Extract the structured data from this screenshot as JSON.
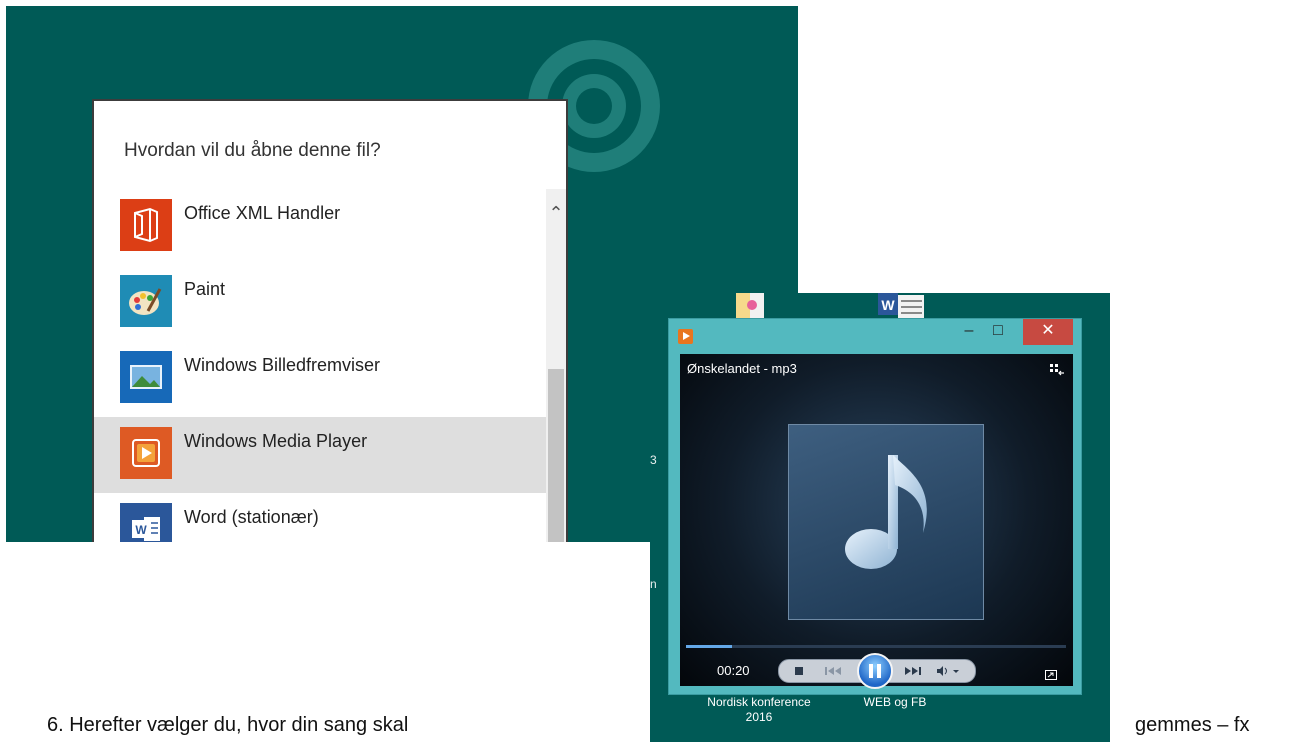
{
  "dialog": {
    "title": "Hvordan vil du åbne denne fil?",
    "apps": [
      {
        "label": "Office XML Handler",
        "icon": "office-icon",
        "selected": false
      },
      {
        "label": "Paint",
        "icon": "paint-icon",
        "selected": false
      },
      {
        "label": "Windows Billedfremviser",
        "icon": "photo-viewer-icon",
        "selected": false
      },
      {
        "label": "Windows Media Player",
        "icon": "media-player-icon",
        "selected": true
      },
      {
        "label": "Word (stationær)",
        "icon": "word-icon",
        "selected": false
      }
    ]
  },
  "media_player": {
    "track_title": "Ønskelandet - mp3",
    "elapsed_time": "00:20",
    "progress": 0.12,
    "state": "playing"
  },
  "desktop": {
    "fragments": [
      "3",
      "n"
    ],
    "labels": [
      "Nordisk konference 2016",
      "WEB og FB"
    ]
  },
  "page_text": {
    "left": "6.   Herefter vælger du, hvor din sang skal",
    "right": "gemmes – fx"
  },
  "colors": {
    "desktop_teal": "#005a56",
    "wmp_frame": "#53b9bf",
    "close_red": "#c74a41",
    "selection_gray": "#dedede"
  }
}
